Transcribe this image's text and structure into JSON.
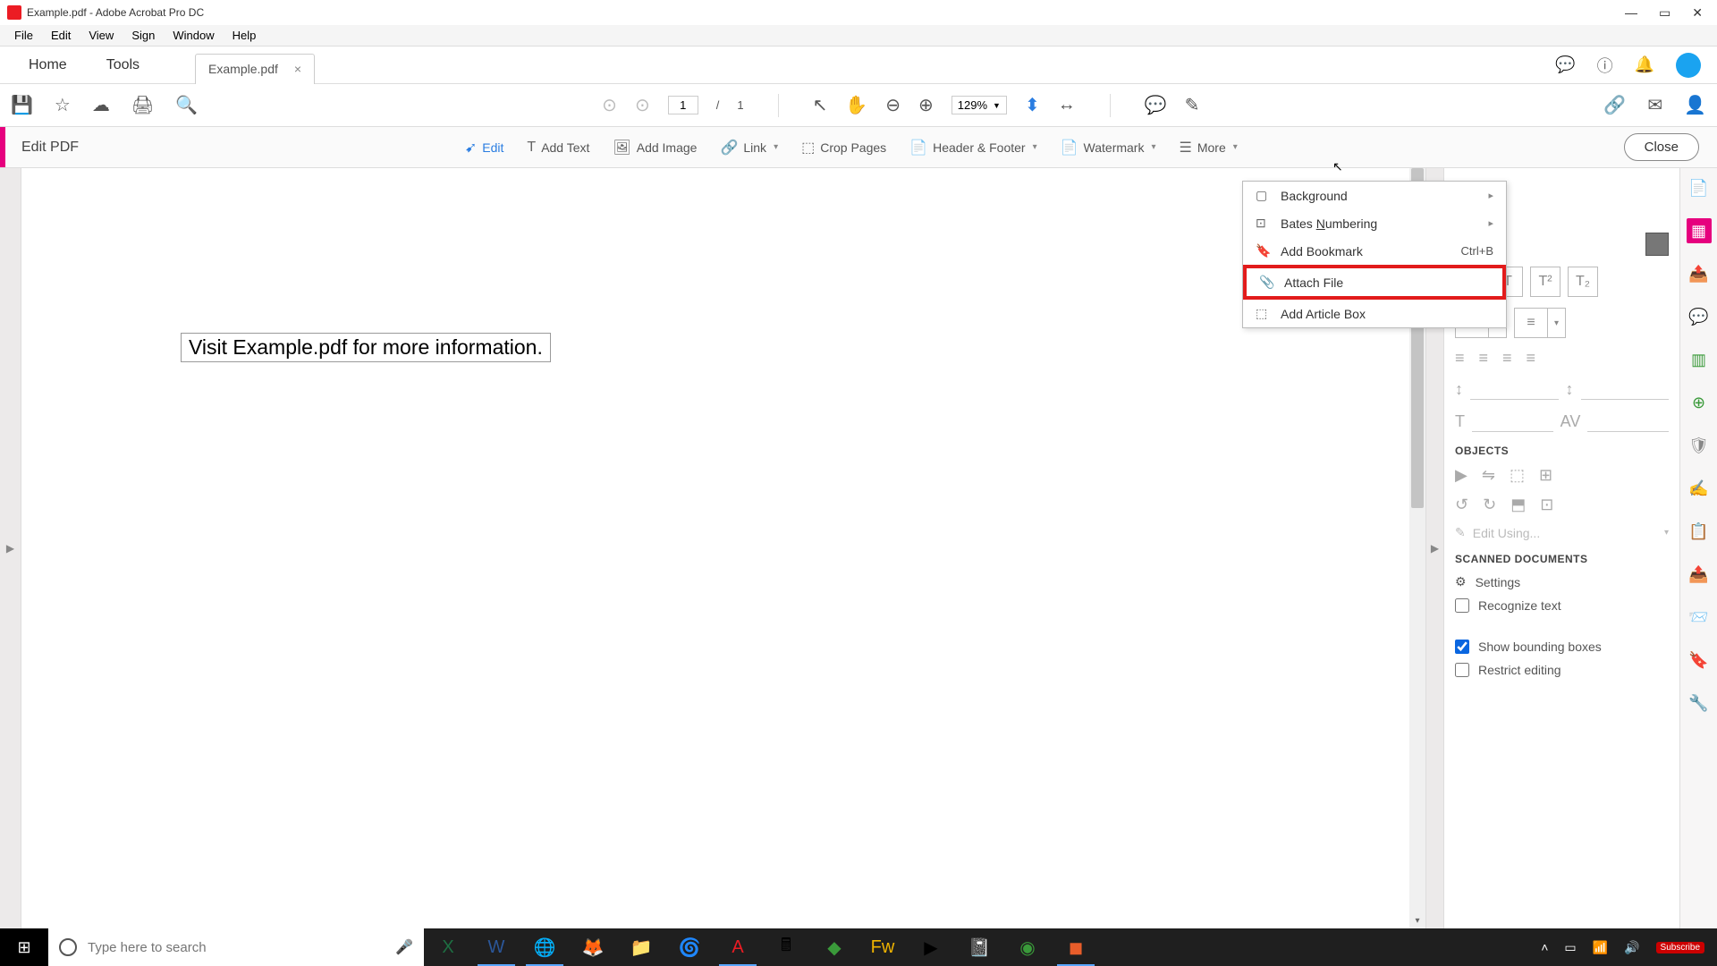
{
  "window": {
    "title": "Example.pdf - Adobe Acrobat Pro DC"
  },
  "menubar": [
    "File",
    "Edit",
    "View",
    "Sign",
    "Window",
    "Help"
  ],
  "tabs": {
    "home": "Home",
    "tools": "Tools",
    "file": "Example.pdf"
  },
  "toolbar": {
    "page_current": "1",
    "page_sep": "/",
    "page_total": "1",
    "zoom": "129%"
  },
  "editbar": {
    "title": "Edit PDF",
    "tools": {
      "edit": "Edit",
      "add_text": "Add Text",
      "add_image": "Add Image",
      "link": "Link",
      "crop": "Crop Pages",
      "header": "Header & Footer",
      "watermark": "Watermark",
      "more": "More"
    },
    "close": "Close"
  },
  "more_menu": {
    "background": "Background",
    "bates_pre": "Bates ",
    "bates_under": "N",
    "bates_post": "umbering",
    "bookmark": "Add Bookmark",
    "bookmark_short": "Ctrl+B",
    "attach": "Attach File",
    "article": "Add Article Box"
  },
  "document": {
    "text": "Visit Example.pdf for more information."
  },
  "right_panel": {
    "objects": "OBJECTS",
    "edit_using": "Edit Using...",
    "scanned": "SCANNED DOCUMENTS",
    "settings": "Settings",
    "recognize": "Recognize text",
    "show_boxes": "Show bounding boxes",
    "restrict": "Restrict editing"
  },
  "taskbar": {
    "search_placeholder": "Type here to search",
    "subscribe": "Subscribe"
  }
}
